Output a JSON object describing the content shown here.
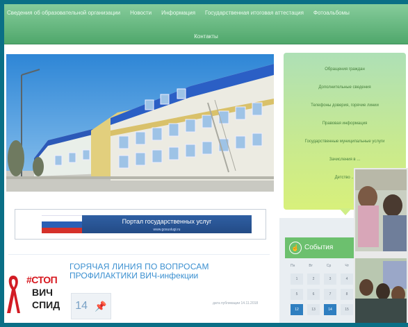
{
  "header": {
    "nav": [
      {
        "label": "Сведения об образовательной организации"
      },
      {
        "label": "Новости"
      },
      {
        "label": "Информация"
      },
      {
        "label": "Государственная итоговая аттестация"
      },
      {
        "label": "Фотоальбомы"
      }
    ],
    "nav_row2": [
      {
        "label": "Контакты"
      }
    ]
  },
  "banner": {
    "title": "Портал государственных услуг",
    "subtitle": "www.gosuslugi.ru"
  },
  "news": {
    "title_line1": "ГОРЯЧАЯ ЛИНИЯ ПО ВОПРОСАМ",
    "title_line2": "ПРОФИЛАКТИКИ ВИЧ-инфекции",
    "day": "14",
    "meta": "дата публикации 14.11.2018"
  },
  "hiv_logo": {
    "stop": "#СТОП",
    "line2": "ВИЧ",
    "line3": "СПИД"
  },
  "sidebar": {
    "items": [
      {
        "label": "Обращения граждан"
      },
      {
        "label": "Дополнительные сведения"
      },
      {
        "label": "Телефоны доверия, горячие линии"
      },
      {
        "label": "Правовая информация"
      },
      {
        "label": "Государственные муниципальные услуги"
      },
      {
        "label": "Зачисления в ..."
      },
      {
        "label": "Детство ..."
      }
    ]
  },
  "events": {
    "title": "События",
    "weekdays": [
      "Пн",
      "Вт",
      "Ср",
      "Чт"
    ],
    "days": [
      "1",
      "2",
      "3",
      "4",
      "5",
      "6",
      "7",
      "8",
      "12",
      "13",
      "14",
      "15"
    ]
  },
  "colors": {
    "frame": "#0a6f86",
    "nav_green": "#5eb57a",
    "sidebar_green": "#c9ea8e",
    "gos_blue": "#2f5fa3",
    "news_blue": "#3a8fd0",
    "stop_red": "#d6161d"
  }
}
